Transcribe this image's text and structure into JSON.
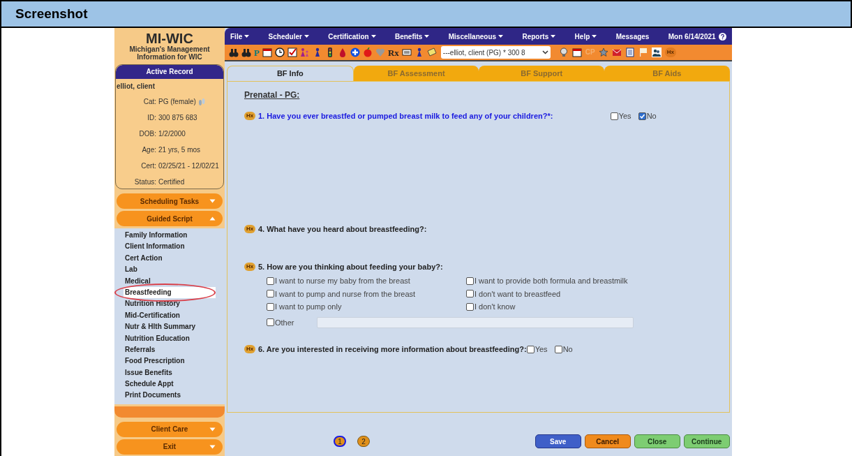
{
  "frame_title": "Screenshot",
  "logo": {
    "title": "MI-WIC",
    "subtitle": "Michigan's Management Information for WIC"
  },
  "menu": [
    {
      "label": "File",
      "dropdown": true
    },
    {
      "label": "Scheduler",
      "dropdown": true
    },
    {
      "label": "Certification",
      "dropdown": true
    },
    {
      "label": "Benefits",
      "dropdown": true
    },
    {
      "label": "Miscellaneous",
      "dropdown": true
    },
    {
      "label": "Reports",
      "dropdown": true
    },
    {
      "label": "Help",
      "dropdown": true
    },
    {
      "label": "Messages",
      "dropdown": false
    }
  ],
  "date": "Mon 6/14/2021",
  "toolbar_left": [
    {
      "kind": "binoculars"
    },
    {
      "kind": "binoculars"
    },
    {
      "kind": "letter",
      "text": "P"
    },
    {
      "kind": "calendar"
    },
    {
      "kind": "clock"
    },
    {
      "kind": "checkbox"
    },
    {
      "kind": "family"
    },
    {
      "kind": "person"
    },
    {
      "kind": "traffic"
    },
    {
      "kind": "drop"
    },
    {
      "kind": "plus"
    },
    {
      "kind": "apple"
    },
    {
      "kind": "heart"
    },
    {
      "kind": "letter",
      "text": "Rx"
    },
    {
      "kind": "card"
    },
    {
      "kind": "person"
    },
    {
      "kind": "note"
    }
  ],
  "client_select": "---elliot, client (PG) * 300 8",
  "toolbar_right": [
    {
      "kind": "bulb"
    },
    {
      "kind": "calendar"
    },
    {
      "kind": "faded",
      "text": "CP"
    },
    {
      "kind": "star"
    },
    {
      "kind": "mail"
    },
    {
      "kind": "document"
    },
    {
      "kind": "flag"
    },
    {
      "kind": "people"
    },
    {
      "kind": "badge",
      "text": "Hx"
    }
  ],
  "active_record": {
    "title": "Active Record",
    "name": "elliot, client",
    "fields": [
      {
        "label": "Cat:",
        "value": "PG (female)",
        "footprints": true
      },
      {
        "label": "ID:",
        "value": "300 875 683",
        "footprints": false
      },
      {
        "label": "DOB:",
        "value": "1/2/2000",
        "footprints": false
      },
      {
        "label": "Age:",
        "value": "21 yrs, 5 mos",
        "footprints": false
      },
      {
        "label": "Cert:",
        "value": "02/25/21 - 12/02/21",
        "footprints": false
      },
      {
        "label": "Status:",
        "value": "Certified",
        "footprints": false
      }
    ]
  },
  "sections": [
    {
      "label": "Scheduling Tasks",
      "expanded": false
    },
    {
      "label": "Guided Script",
      "expanded": true,
      "items": [
        {
          "label": "Family Information",
          "selected": false
        },
        {
          "label": "Client Information",
          "selected": false
        },
        {
          "label": "Cert Action",
          "selected": false
        },
        {
          "label": "Lab",
          "selected": false
        },
        {
          "label": "Medical",
          "selected": false
        },
        {
          "label": "Breastfeeding",
          "selected": true
        },
        {
          "label": "Nutrition History",
          "selected": false
        },
        {
          "label": "Mid-Certification",
          "selected": false
        },
        {
          "label": "Nutr & Hlth Summary",
          "selected": false
        },
        {
          "label": "Nutrition Education",
          "selected": false
        },
        {
          "label": "Referrals",
          "selected": false
        },
        {
          "label": "Food Prescription",
          "selected": false
        },
        {
          "label": "Issue Benefits",
          "selected": false
        },
        {
          "label": "Schedule Appt",
          "selected": false
        },
        {
          "label": "Print Documents",
          "selected": false
        }
      ]
    },
    {
      "label": "Client Care",
      "expanded": false
    },
    {
      "label": "Exit",
      "expanded": false
    }
  ],
  "tabs": [
    {
      "label": "BF Info",
      "selected": true
    },
    {
      "label": "BF Assessment",
      "selected": false
    },
    {
      "label": "BF Support",
      "selected": false
    },
    {
      "label": "BF Aids",
      "selected": false
    }
  ],
  "heading": "Prenatal - PG:",
  "questions": [
    {
      "badge": "Hx",
      "text": "1. Have you ever breastfed or pumped breast milk to feed any of your children?*:",
      "required": true,
      "kind": "yesno",
      "options": [
        {
          "label": "Yes",
          "checked": false
        },
        {
          "label": "No",
          "checked": true
        }
      ]
    },
    {
      "badge": "Hx",
      "text": "4. What have you heard about breastfeeding?:",
      "required": false,
      "kind": "none"
    },
    {
      "badge": "Hx",
      "text": "5. How are you thinking about feeding your baby?:",
      "required": false,
      "kind": "grid",
      "options": [
        {
          "label": "I want to nurse my baby from the breast",
          "checked": false
        },
        {
          "label": "I want to provide both formula and breastmilk",
          "checked": false
        },
        {
          "label": "I want to pump and nurse from the breast",
          "checked": false
        },
        {
          "label": "I don't want to breastfeed",
          "checked": false
        },
        {
          "label": "I want to pump only",
          "checked": false
        },
        {
          "label": "I don't know",
          "checked": false
        }
      ],
      "other": {
        "label": "Other",
        "checked": false
      }
    },
    {
      "badge": "Hx",
      "text": "6. Are you interested in receiving more information about breastfeeding?:",
      "required": false,
      "kind": "yesno",
      "options": [
        {
          "label": "Yes",
          "checked": false
        },
        {
          "label": "No",
          "checked": false
        }
      ]
    }
  ],
  "pages": [
    {
      "label": "1",
      "selected": true
    },
    {
      "label": "2",
      "selected": false
    }
  ],
  "buttons": [
    {
      "label": "Save",
      "kind": "primary"
    },
    {
      "label": "Cancel",
      "kind": "warning"
    },
    {
      "label": "Close",
      "kind": "success"
    },
    {
      "label": "Continue",
      "kind": "success"
    }
  ]
}
